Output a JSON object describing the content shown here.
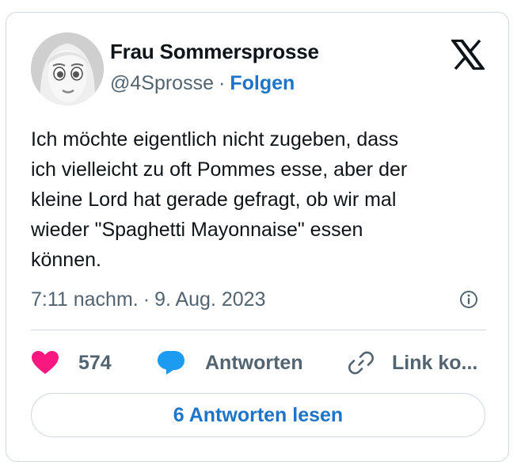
{
  "author": {
    "name": "Frau Sommersprosse",
    "handle": "@4Sprosse",
    "separator": "·",
    "follow_label": "Folgen"
  },
  "tweet": {
    "lines": [
      "Ich möchte eigentlich nicht zugeben, dass",
      "ich vielleicht zu oft Pommes esse, aber der",
      "kleine Lord hat gerade gefragt, ob wir mal",
      "wieder \"Spaghetti Mayonnaise\" essen",
      "können."
    ],
    "time": "7:11 nachm.",
    "date": "9. Aug. 2023",
    "meta_separator": "·"
  },
  "actions": {
    "likes": "574",
    "reply_label": "Antworten",
    "copy_link_label": "Link ko..."
  },
  "read_replies_label": "6 Antworten lesen",
  "icons": {
    "brand": "x-logo-icon",
    "info": "info-icon",
    "like": "heart-icon",
    "reply": "speech-bubble-icon",
    "link": "link-icon"
  },
  "colors": {
    "heart": "#f91880",
    "reply_bubble": "#1d9bf0",
    "link_accent": "#1d74c9",
    "muted_text": "#536471",
    "border": "#cfd9de"
  }
}
